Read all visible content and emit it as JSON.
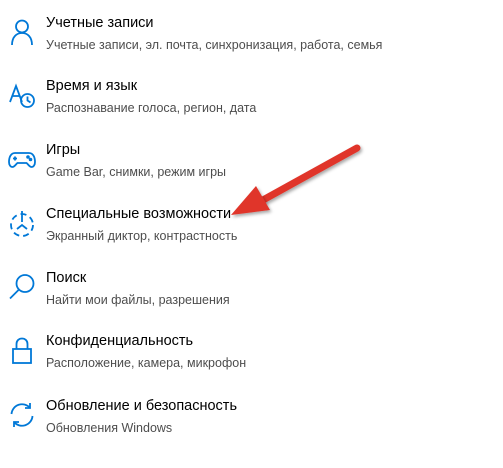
{
  "accent_color": "#0078d7",
  "annotation_arrow_color": "#e0352b",
  "settings_items": [
    {
      "title": "Учетные записи",
      "description": "Учетные записи, эл. почта, синхронизация, работа, семья",
      "icon": "person-icon"
    },
    {
      "title": "Время и язык",
      "description": "Распознавание голоса, регион, дата",
      "icon": "time-language-icon"
    },
    {
      "title": "Игры",
      "description": "Game Bar, снимки, режим игры",
      "icon": "gamepad-icon"
    },
    {
      "title": "Специальные возможности",
      "description": "Экранный диктор, контрастность",
      "icon": "ease-of-access-icon"
    },
    {
      "title": "Поиск",
      "description": "Найти мои файлы, разрешения",
      "icon": "search-icon"
    },
    {
      "title": "Конфиденциальность",
      "description": "Расположение, камера, микрофон",
      "icon": "lock-icon"
    },
    {
      "title": "Обновление и безопасность",
      "description": "Обновления Windows",
      "icon": "sync-icon"
    }
  ]
}
